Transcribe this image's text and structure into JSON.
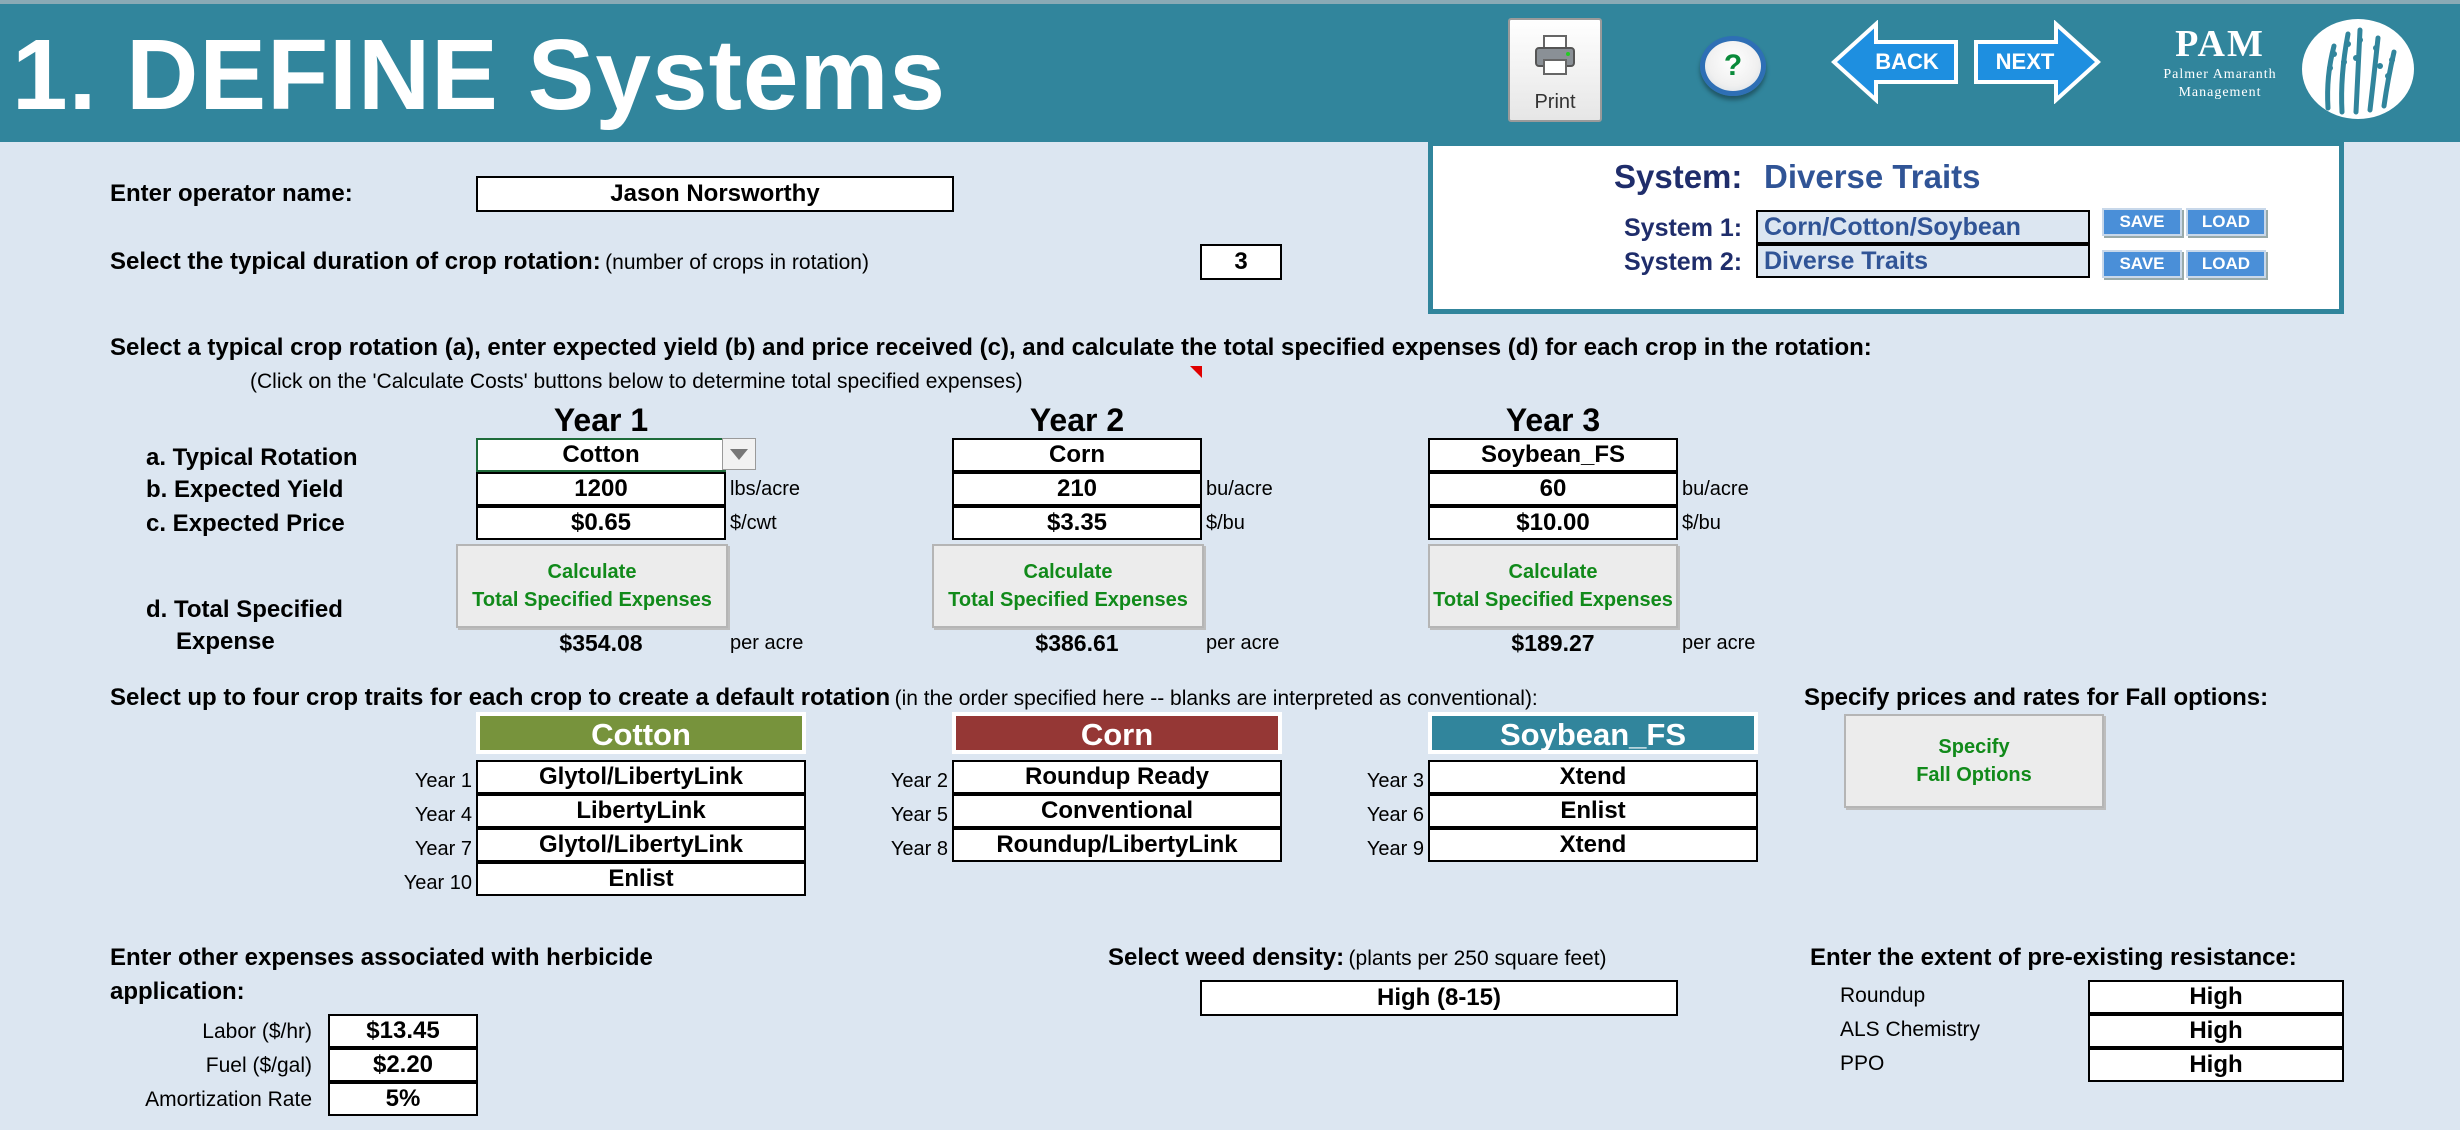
{
  "header": {
    "title": "1. DEFINE Systems",
    "print_label": "Print",
    "help_label": "?",
    "back_label": "BACK",
    "next_label": "NEXT",
    "pam_title": "PAM",
    "pam_line1": "Palmer Amaranth",
    "pam_line2": "Management"
  },
  "operator": {
    "label": "Enter operator name:",
    "value": "Jason Norsworthy"
  },
  "duration": {
    "label": "Select the typical duration of crop rotation:",
    "hint": "(number of  crops in rotation)",
    "value": "3"
  },
  "system_panel": {
    "label": "System:",
    "current": "Diverse Traits",
    "system1_label": "System 1:",
    "system1_value": "Corn/Cotton/Soybean",
    "system2_label": "System 2:",
    "system2_value": "Diverse Traits",
    "save_label": "SAVE",
    "load_label": "LOAD"
  },
  "rotation": {
    "instruction": "Select a typical crop rotation (a), enter expected yield (b) and price received (c), and calculate the total specified expenses (d) for each crop in the rotation:",
    "sub_instruction": "(Click on the 'Calculate Costs' buttons below to determine total specified expenses)",
    "row_a": "a. Typical Rotation",
    "row_b": "b. Expected Yield",
    "row_c": "c. Expected Price",
    "row_d1": "d.  Total Specified",
    "row_d2": "Expense",
    "calc_line1": "Calculate",
    "calc_line2": "Total Specified Expenses",
    "per_acre": "per acre",
    "years": [
      {
        "label": "Year 1",
        "crop": "Cotton",
        "yield": "1200",
        "yield_unit": "lbs/acre",
        "price": "$0.65",
        "price_unit": "$/cwt",
        "total": "$354.08"
      },
      {
        "label": "Year 2",
        "crop": "Corn",
        "yield": "210",
        "yield_unit": "bu/acre",
        "price": "$3.35",
        "price_unit": "$/bu",
        "total": "$386.61"
      },
      {
        "label": "Year 3",
        "crop": "Soybean_FS",
        "yield": "60",
        "yield_unit": "bu/acre",
        "price": "$10.00",
        "price_unit": "$/bu",
        "total": "$189.27"
      }
    ]
  },
  "traits": {
    "instruction": "Select up to four crop traits for each crop to create a default rotation",
    "instruction_hint": "(in the order specified here -- blanks are interpreted as conventional):",
    "crops": [
      {
        "name": "Cotton",
        "color": "#77933c",
        "rows": [
          {
            "year": "Year 1",
            "trait": "Glytol/LibertyLink"
          },
          {
            "year": "Year 4",
            "trait": "LibertyLink"
          },
          {
            "year": "Year 7",
            "trait": "Glytol/LibertyLink"
          },
          {
            "year": "Year 10",
            "trait": "Enlist"
          }
        ]
      },
      {
        "name": "Corn",
        "color": "#953735",
        "rows": [
          {
            "year": "Year 2",
            "trait": "Roundup Ready"
          },
          {
            "year": "Year 5",
            "trait": "Conventional"
          },
          {
            "year": "Year 8",
            "trait": "Roundup/LibertyLink"
          }
        ]
      },
      {
        "name": "Soybean_FS",
        "color": "#31859c",
        "rows": [
          {
            "year": "Year 3",
            "trait": "Xtend"
          },
          {
            "year": "Year 6",
            "trait": "Enlist"
          },
          {
            "year": "Year 9",
            "trait": "Xtend"
          }
        ]
      }
    ]
  },
  "fall": {
    "label": "Specify prices and rates for Fall options:",
    "btn_line1": "Specify",
    "btn_line2": "Fall Options"
  },
  "expenses": {
    "label_line1": "Enter other expenses associated with herbicide",
    "label_line2": "application:",
    "labor_label": "Labor ($/hr)",
    "labor_value": "$13.45",
    "fuel_label": "Fuel ($/gal)",
    "fuel_value": "$2.20",
    "amort_label": "Amortization Rate",
    "amort_value": "5%"
  },
  "weed": {
    "label": "Select weed density:",
    "hint": "(plants per 250 square feet)",
    "value": "High (8-15)"
  },
  "resistance": {
    "label": "Enter the extent of pre-existing resistance:",
    "rows": [
      {
        "name": "Roundup",
        "value": "High"
      },
      {
        "name": "ALS Chemistry",
        "value": "High"
      },
      {
        "name": "PPO",
        "value": "High"
      }
    ]
  }
}
